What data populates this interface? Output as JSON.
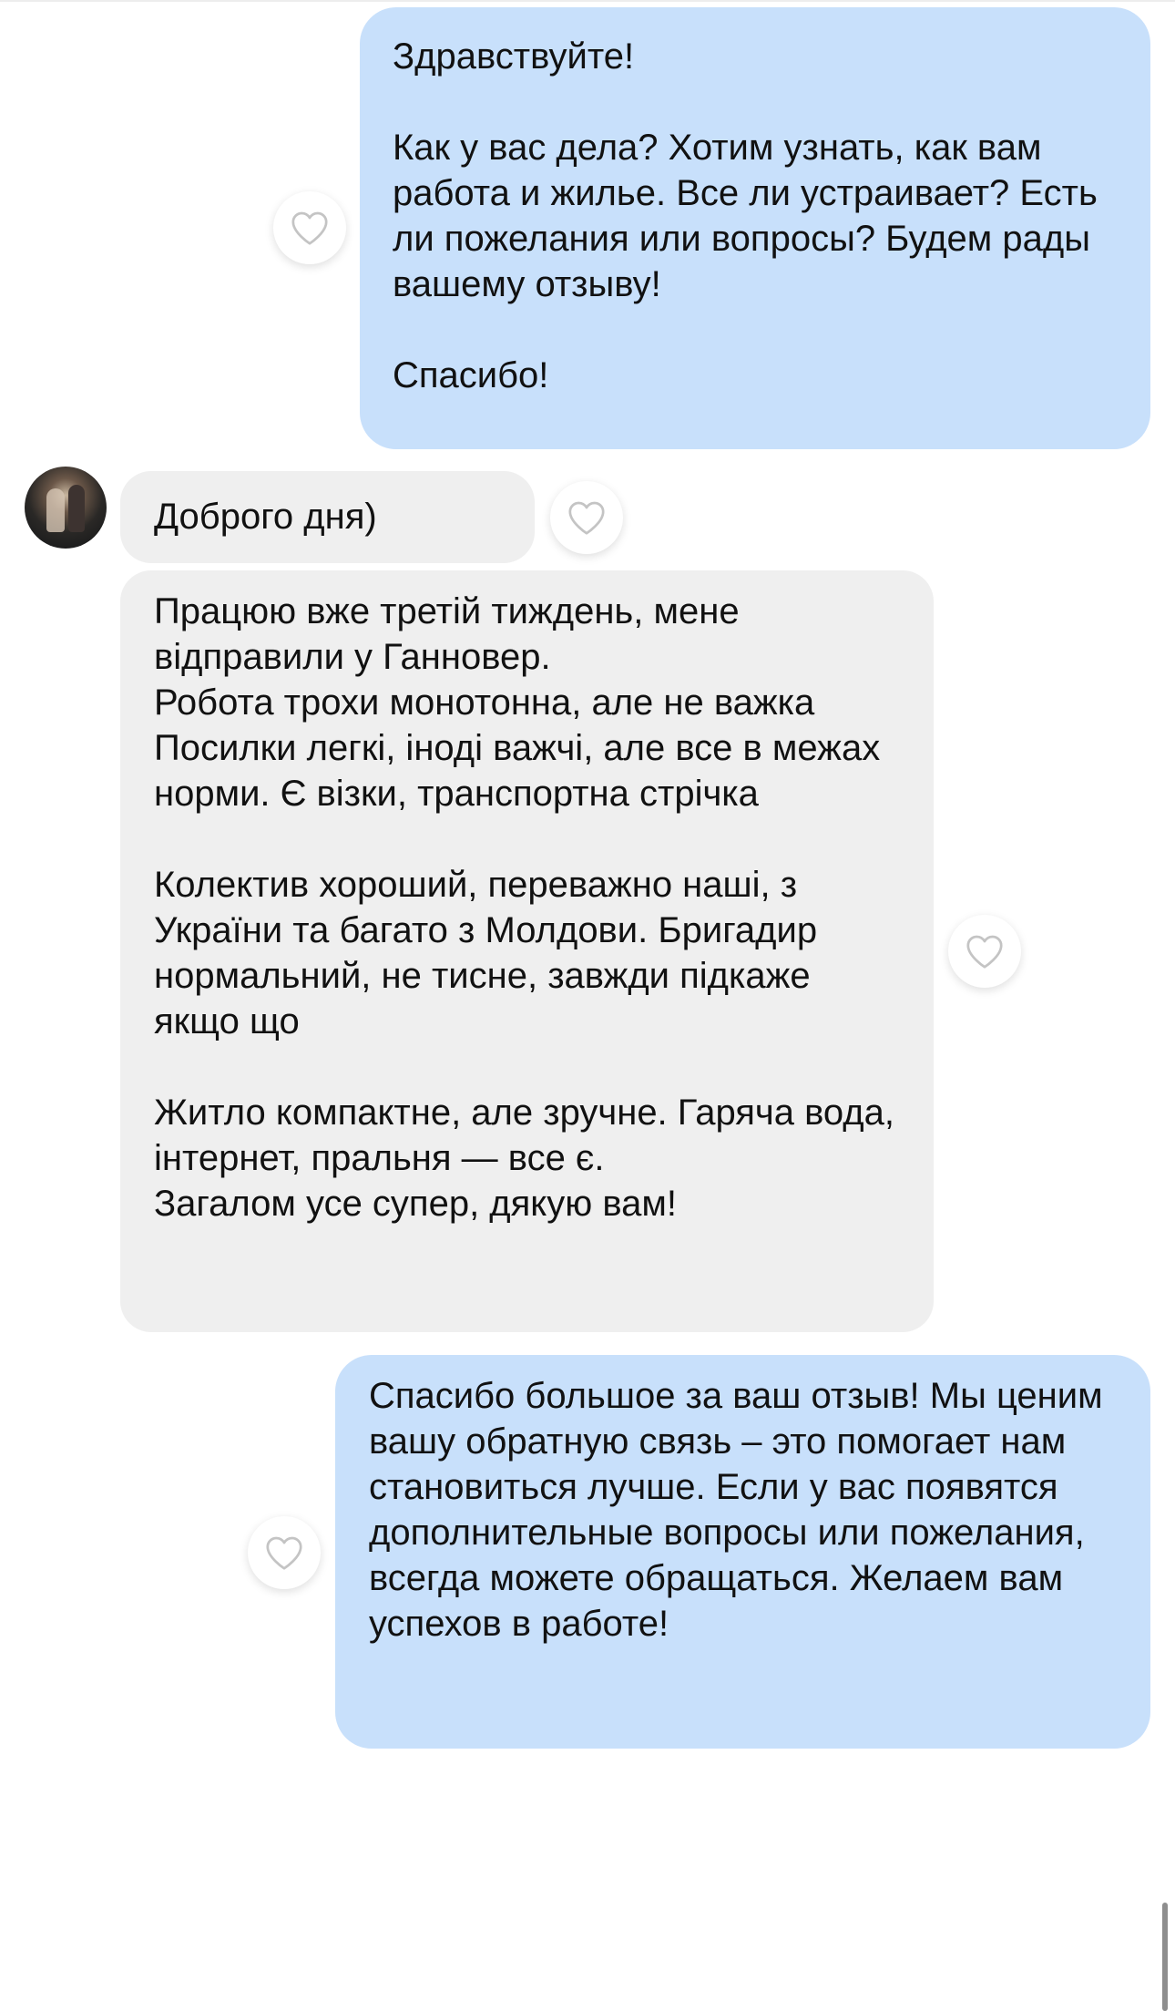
{
  "messages": [
    {
      "direction": "outgoing",
      "text": "Здравствуйте!\n\nКак у вас дела? Хотим узнать, как вам работа и жилье. Все ли устраивает? Есть ли пожелания или вопросы? Будем рады вашему отзыву!\n\nСпасибо!"
    },
    {
      "direction": "incoming",
      "text": "Доброго дня)"
    },
    {
      "direction": "incoming",
      "text": "Працюю вже третій тиждень, мене відправили у Ганновер.\nРобота трохи монотонна, але не важка\nПосилки легкі, іноді важчі, але все в межах норми. Є візки, транспортна стрічка\n\nКолектив хороший, переважно наші, з України та багато з Молдови. Бригадир нормальний, не тисне, завжди підкаже якщо що\n\nЖитло компактне, але зручне. Гаряча вода, інтернет, пральня — все є.\nЗагалом усе супер, дякую вам!"
    },
    {
      "direction": "outgoing",
      "text": "Спасибо большое за ваш отзыв! Мы ценим вашу обратную связь – это помогает нам становиться лучше. Если у вас появятся дополнительные вопросы или пожелания, всегда можете обращаться. Желаем вам успехов в работе!"
    }
  ],
  "icons": {
    "like": "heart-outline-icon",
    "avatar": "user-avatar-photo"
  },
  "colors": {
    "outgoing_bubble": "#c8e0fb",
    "incoming_bubble": "#efefef",
    "text": "#111111",
    "like_icon": "#c4c4c4"
  }
}
